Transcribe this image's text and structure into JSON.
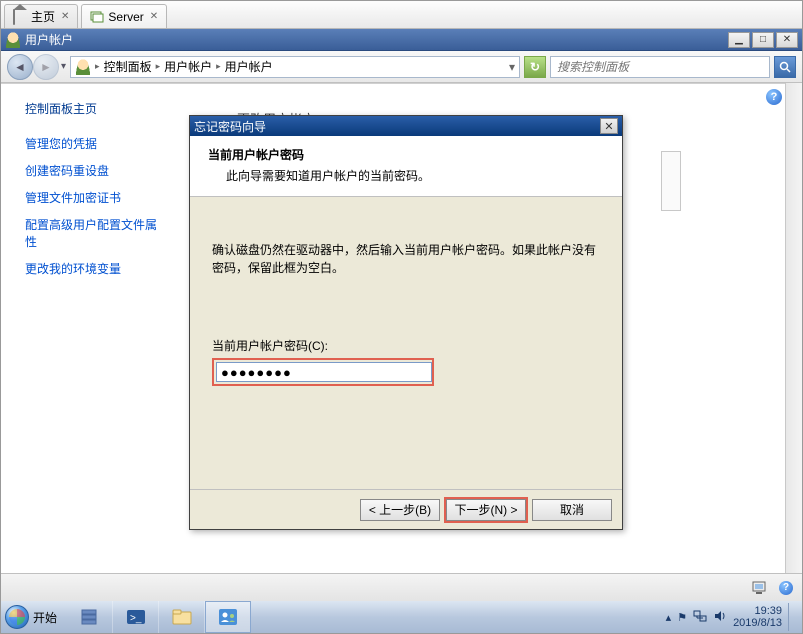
{
  "tabs": {
    "home": "主页",
    "server": "Server"
  },
  "window": {
    "title": "用户帐户"
  },
  "nav": {
    "crumbs": [
      "控制面板",
      "用户帐户",
      "用户帐户"
    ],
    "search_placeholder": "搜索控制面板"
  },
  "sidebar": {
    "home": "控制面板主页",
    "links": [
      "管理您的凭据",
      "创建密码重设盘",
      "管理文件加密证书",
      "配置高级用户配置文件属性",
      "更改我的环境变量"
    ]
  },
  "behind_dialog": "更改用户帐户",
  "dialog": {
    "title": "忘记密码向导",
    "heading": "当前用户帐户密码",
    "subheading": "此向导需要知道用户帐户的当前密码。",
    "instruction": "确认磁盘仍然在驱动器中，然后输入当前用户帐户密码。如果此帐户没有密码，保留此框为空白。",
    "field_label": "当前用户帐户密码(C):",
    "password_value": "●●●●●●●●",
    "back": "< 上一步(B)",
    "next": "下一步(N) >",
    "cancel": "取消"
  },
  "taskbar": {
    "start": "开始",
    "time": "19:39",
    "date": "2019/8/13"
  }
}
